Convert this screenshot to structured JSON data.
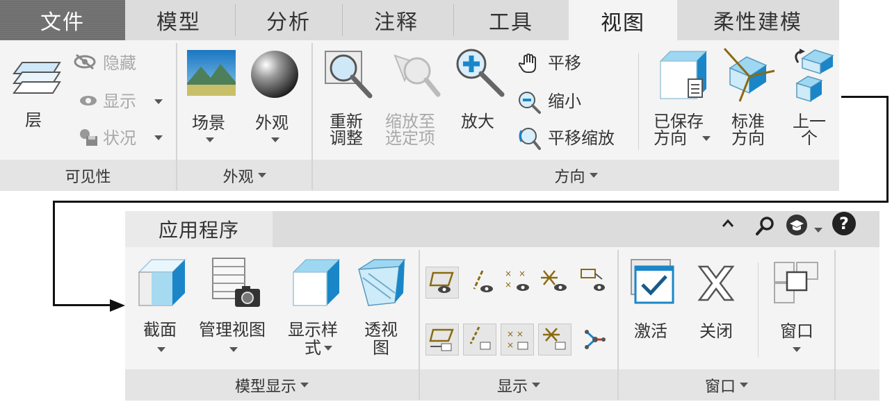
{
  "ribbon": {
    "tabs": [
      "文件",
      "模型",
      "分析",
      "注释",
      "工具",
      "视图",
      "柔性建模"
    ],
    "active_tab": "视图",
    "groups": {
      "visibility": {
        "label": "可见性",
        "layer": "层",
        "hide": "隐藏",
        "show": "显示",
        "status": "状况"
      },
      "appearance": {
        "label": "外观",
        "scene": "场景",
        "appearance": "外观"
      },
      "orientation": {
        "label": "方向",
        "refit_1": "重新",
        "refit_2": "调整",
        "zoom_sel_1": "缩放至",
        "zoom_sel_2": "选定项",
        "zoom_in": "放大",
        "pan": "平移",
        "zoom_out": "缩小",
        "pan_zoom": "平移缩放",
        "saved_1": "已保存",
        "saved_2": "方向",
        "std_1": "标准",
        "std_2": "方向",
        "prev_1": "上一",
        "prev_2": "个"
      }
    }
  },
  "ribbon2": {
    "tab": "应用程序",
    "groups": {
      "model_display": {
        "label": "模型显示",
        "section": "截面",
        "manage_views": "管理视图",
        "display_style_1": "显示样",
        "display_style_2": "式",
        "perspective_1": "透视",
        "perspective_2": "图"
      },
      "display": {
        "label": "显示"
      },
      "window": {
        "label": "窗口",
        "activate": "激活",
        "close": "关闭",
        "window": "窗口"
      }
    }
  },
  "colors": {
    "accent_blue": "#1a86c8",
    "file_tab": "#6f6f6f"
  }
}
